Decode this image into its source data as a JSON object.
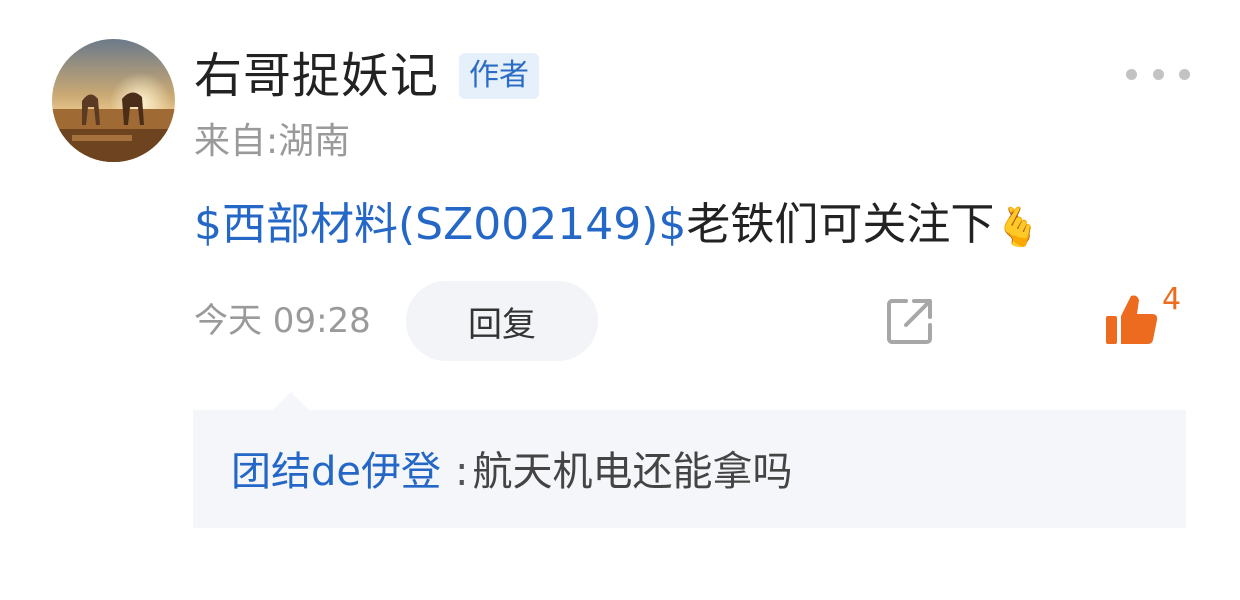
{
  "comment": {
    "username": "右哥捉妖记",
    "badge": "作者",
    "location": "来自:湖南",
    "stock_link": "$西部材料(SZ002149)$",
    "text": "老铁们可关注下",
    "emoji": "🫰",
    "time": "今天 09:28",
    "reply_label": "回复",
    "like_count": "4"
  },
  "icons": {
    "more": "more-dots-icon",
    "share": "share-icon",
    "like": "thumbs-up-icon"
  },
  "colors": {
    "link": "#2467c7",
    "like": "#ec6b1e",
    "badge_bg": "#e6f0fb"
  },
  "sub_reply": {
    "user": "团结de伊登",
    "separator": ":",
    "text": "航天机电还能拿吗"
  }
}
